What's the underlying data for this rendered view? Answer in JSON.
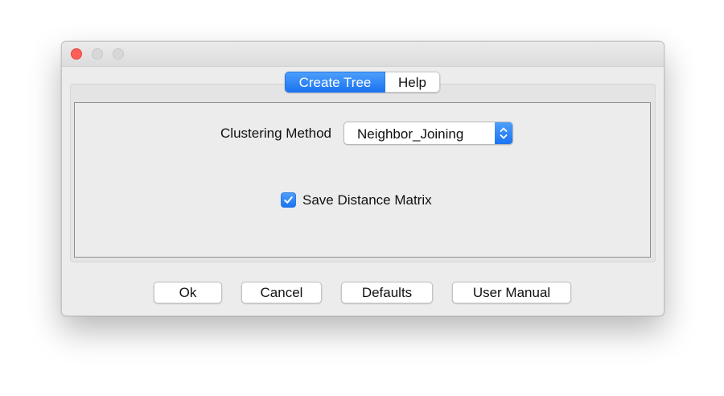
{
  "window": {
    "traffic_lights": [
      "close",
      "minimize",
      "maximize"
    ]
  },
  "tabs": [
    {
      "label": "Create Tree",
      "active": true
    },
    {
      "label": "Help",
      "active": false
    }
  ],
  "form": {
    "clustering_label": "Clustering Method",
    "clustering_value": "Neighbor_Joining",
    "save_matrix_label": "Save Distance Matrix",
    "save_matrix_checked": true
  },
  "buttons": {
    "ok": "Ok",
    "cancel": "Cancel",
    "defaults": "Defaults",
    "manual": "User Manual"
  },
  "colors": {
    "accent": "#1b73f0",
    "close_light": "#fe5f57"
  },
  "icons": {
    "select_arrows": "up-down-chevrons-icon",
    "checkbox": "checkmark-icon"
  }
}
